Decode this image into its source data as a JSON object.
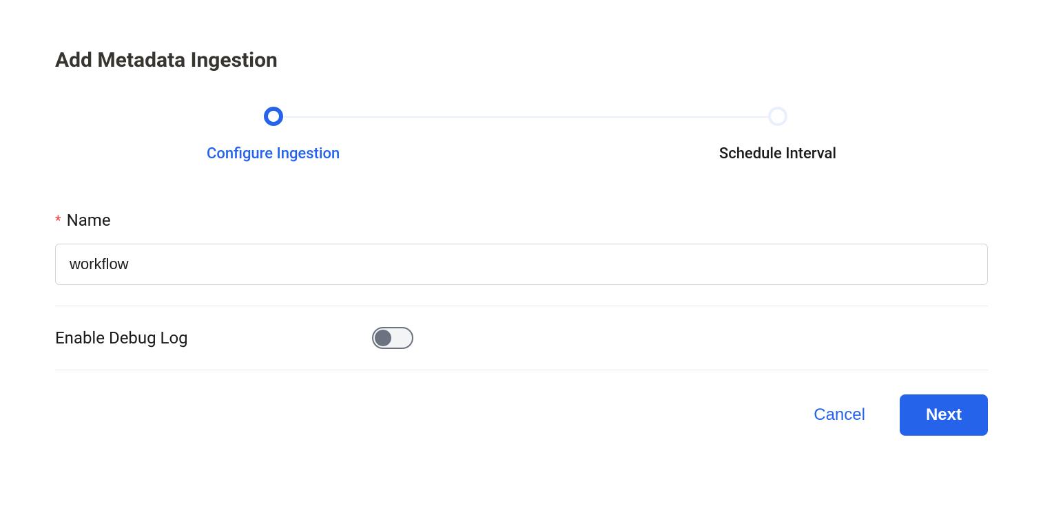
{
  "page": {
    "title": "Add Metadata Ingestion"
  },
  "stepper": {
    "steps": [
      {
        "label": "Configure Ingestion",
        "active": true
      },
      {
        "label": "Schedule Interval",
        "active": false
      }
    ]
  },
  "form": {
    "name": {
      "label": "Name",
      "required_marker": "*",
      "value": "workflow"
    },
    "debug_log": {
      "label": "Enable Debug Log",
      "enabled": false
    }
  },
  "buttons": {
    "cancel": "Cancel",
    "next": "Next"
  }
}
